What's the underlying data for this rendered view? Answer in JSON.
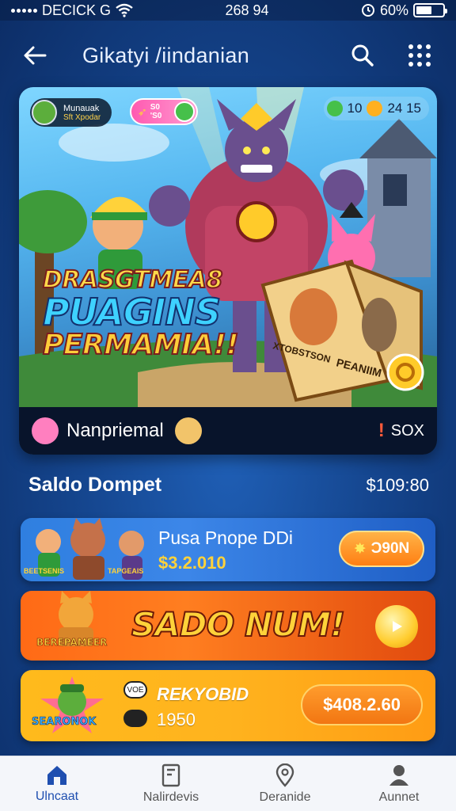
{
  "status_bar": {
    "carrier": "DECICK G",
    "time": "268 94",
    "battery": "60%",
    "battery_level": 0.6
  },
  "app_bar": {
    "title": "Gikatyi /iindanian",
    "back_icon": "back-arrow-icon",
    "search_icon": "search-icon",
    "menu_icon": "grid-menu-icon"
  },
  "banner": {
    "player_name": "Munauak",
    "player_sub": "Sft Xpodar",
    "pink_chip_top": "S0",
    "pink_chip_bottom": "'S0",
    "stat_a": "10",
    "stat_b": "24 15",
    "title_line1": "DRASGTMEA8",
    "title_line2": "PUAGINS",
    "title_line3": "PERMAMIA!!",
    "card_label_a": "XTOBSTSON",
    "card_label_b": "PEANIIM",
    "footer_label": "Nanpriemal",
    "footer_right": "SOX"
  },
  "wallet": {
    "title": "Saldo Dompet",
    "amount": "$109:80"
  },
  "cards": {
    "card1": {
      "title": "Pusa Pnope DDi",
      "amount": "$3.2.010",
      "button": "Ͻ90N",
      "art_label_left": "BEETSENIS",
      "art_label_right": "TAPGEAIS"
    },
    "card2": {
      "title": "SADO NUM!",
      "logo": "BEREPAMEER"
    },
    "card3": {
      "icon_text": "VOE",
      "title": "REKYOBID",
      "subtitle": "1950",
      "button": "$408.2.60",
      "logo": "SEARONOK"
    }
  },
  "bottom_nav": {
    "items": [
      {
        "label": "Ulncaat",
        "icon": "home-icon",
        "active": true
      },
      {
        "label": "Nalirdevis",
        "icon": "tablet-icon",
        "active": false
      },
      {
        "label": "Deranide",
        "icon": "location-pin-icon",
        "active": false
      },
      {
        "label": "Aunnet",
        "icon": "user-icon",
        "active": false
      }
    ]
  },
  "colors": {
    "background": "#15468f",
    "accent_orange": "#ff7f13",
    "accent_yellow": "#ffd23a",
    "nav_active": "#1f4fb0"
  }
}
